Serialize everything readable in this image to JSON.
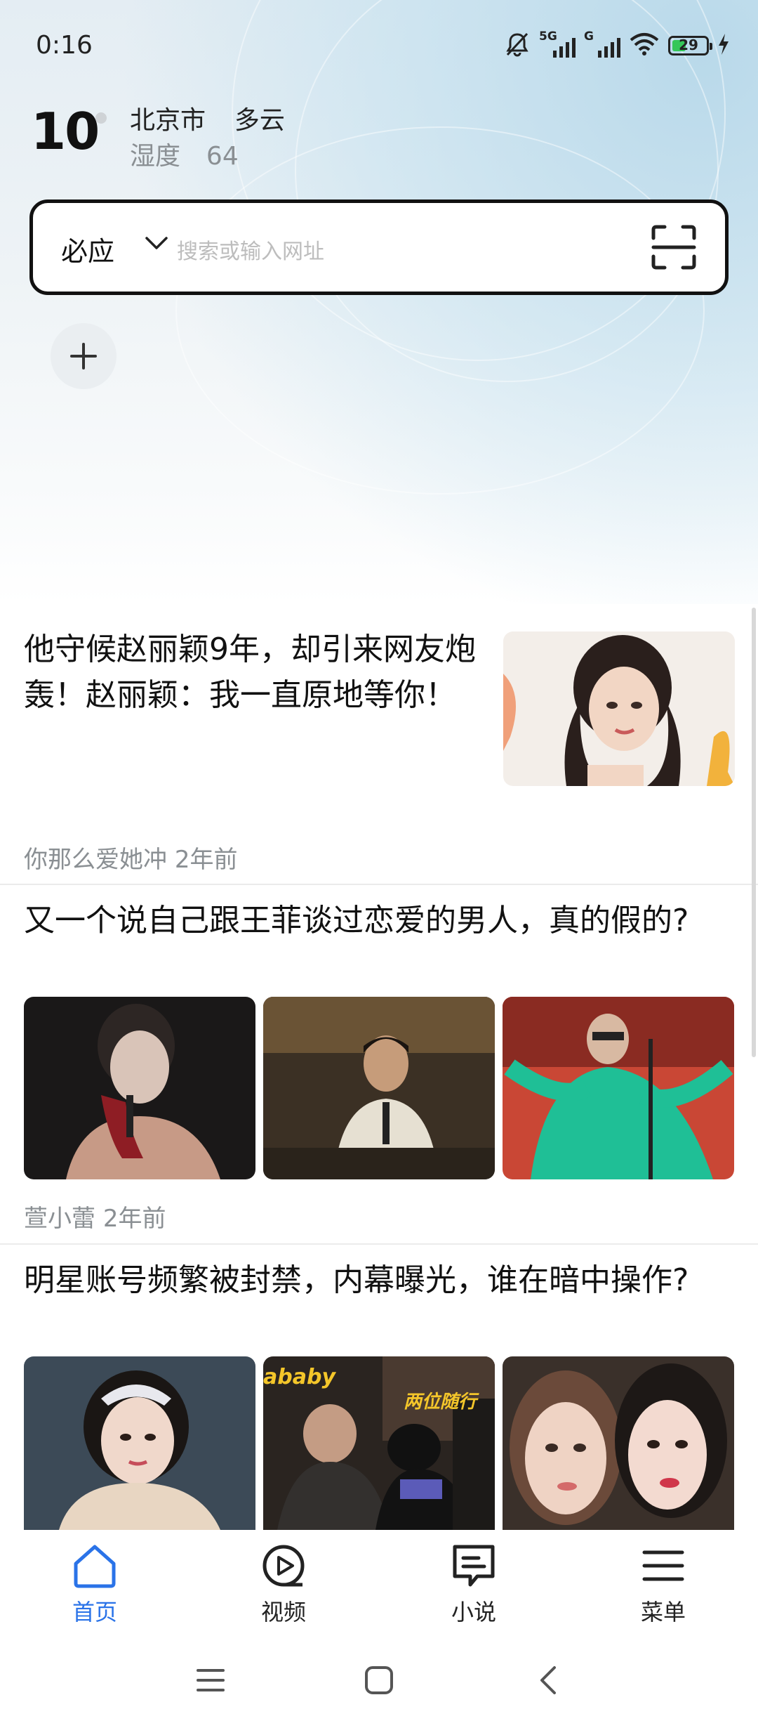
{
  "status_bar": {
    "time": "0:16",
    "network_1": "5G",
    "network_2": "G",
    "battery": "29"
  },
  "weather": {
    "temperature": "10",
    "city": "北京市",
    "condition": "多云",
    "humidity_label": "湿度",
    "humidity_value": "64"
  },
  "search": {
    "engine": "必应",
    "placeholder": "搜索或输入网址"
  },
  "feed": [
    {
      "title": "他守候赵丽颖9年，却引来网友炮轰！赵丽颖：我一直原地等你！",
      "source": "你那么爱她冲",
      "time": "2年前"
    },
    {
      "title": "又一个说自己跟王菲谈过恋爱的男人，真的假的?",
      "source": "萱小蕾",
      "time": "2年前"
    },
    {
      "title": "明星账号频繁被封禁，内幕曝光，谁在暗中操作?",
      "overlay_1": "ababy",
      "overlay_2": "两位随行"
    }
  ],
  "bottom_nav": [
    {
      "label": "首页",
      "icon": "home-icon",
      "active": true
    },
    {
      "label": "视频",
      "icon": "video-icon",
      "active": false
    },
    {
      "label": "小说",
      "icon": "novel-icon",
      "active": false
    },
    {
      "label": "菜单",
      "icon": "menu-icon",
      "active": false
    }
  ],
  "colors": {
    "accent": "#2a73e8",
    "text": "#111111",
    "meta": "#8a8f93"
  }
}
